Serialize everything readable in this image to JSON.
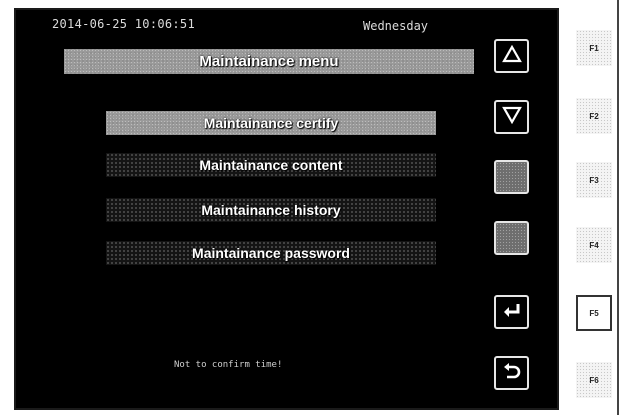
{
  "status": {
    "datetime": "2014-06-25 10:06:51",
    "weekday": "Wednesday"
  },
  "menu": {
    "title": "Maintainance menu",
    "items": [
      {
        "label": "Maintainance certify",
        "selected": true
      },
      {
        "label": "Maintainance content",
        "selected": false
      },
      {
        "label": "Maintainance history",
        "selected": false
      },
      {
        "label": "Maintainance password",
        "selected": false
      }
    ]
  },
  "message": "Not to confirm time!",
  "softkeys": [
    {
      "icon": "arrow-up-icon"
    },
    {
      "icon": "arrow-down-icon"
    },
    {
      "icon": "blank"
    },
    {
      "icon": "blank"
    },
    {
      "icon": "enter-icon"
    },
    {
      "icon": "return-icon"
    }
  ],
  "function_keys": [
    "F1",
    "F2",
    "F3",
    "F4",
    "F5",
    "F6"
  ],
  "colors": {
    "screen_bg": "#000000",
    "bar_grey": "#9a9a9a",
    "text": "#ffffff",
    "button_border": "#e6e6e6"
  }
}
